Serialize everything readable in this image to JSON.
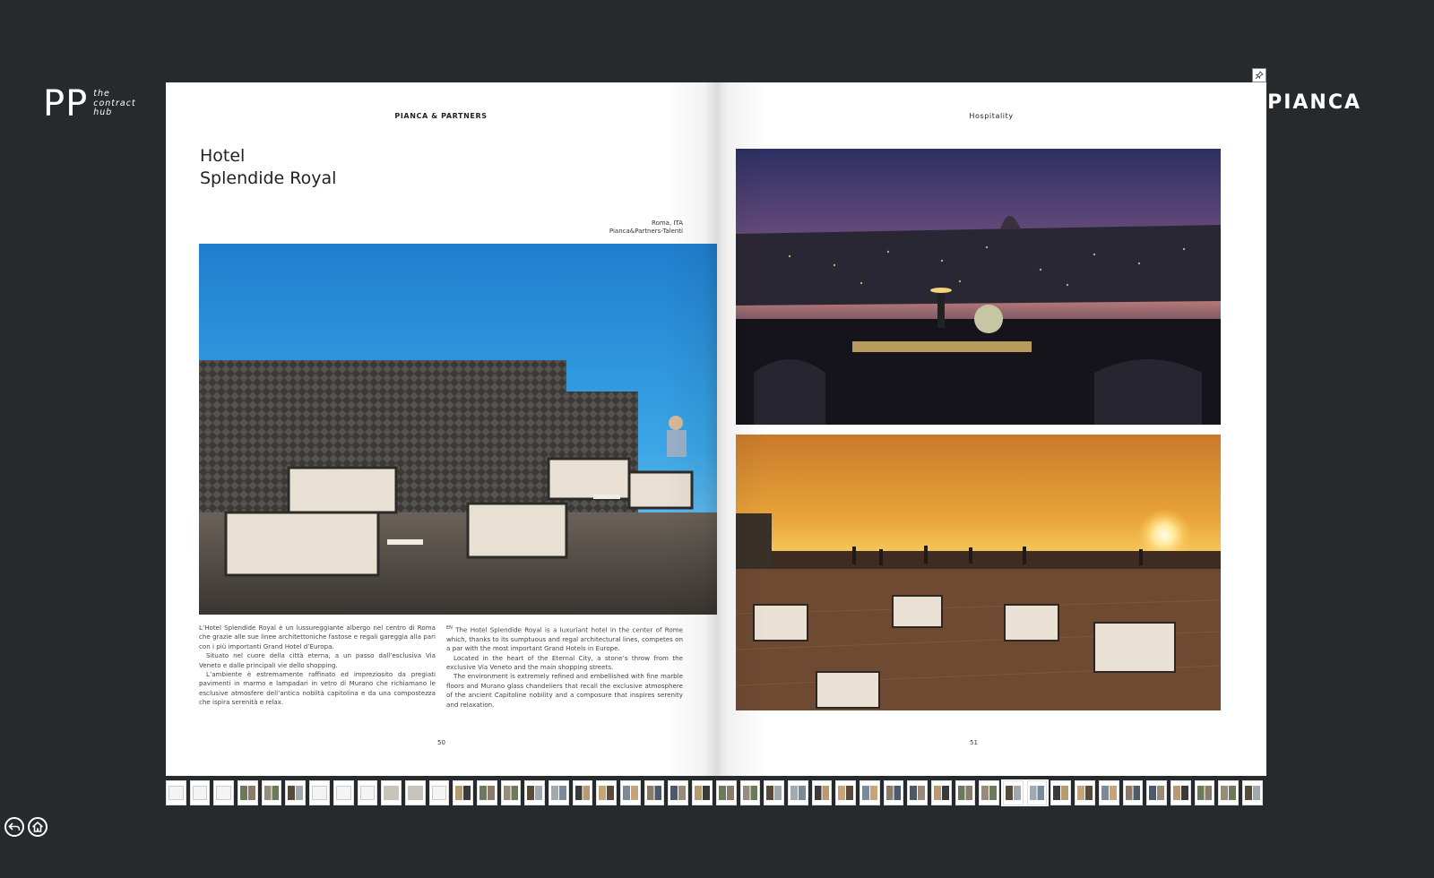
{
  "brand": {
    "pp_mark": "PP",
    "pp_tagline_1": "the",
    "pp_tagline_2": "contract",
    "pp_tagline_3": "hub",
    "pianca": "PIANCA"
  },
  "left_page": {
    "running_head": "PIANCA & PARTNERS",
    "title_line_1": "Hotel",
    "title_line_2": "Splendide Royal",
    "location_line_1": "Roma, ITA",
    "location_line_2": "Pianca&Partners-Talenti",
    "italian_paragraphs": [
      "L’Hotel Splendide Royal è un lussureggiante albergo nel centro di Roma che grazie alle sue linee architettoniche fastose e regali gareggia alla pari con i più importanti Grand Hotel d’Europa.",
      "Situato nel cuore della città eterna, a un passo dall’esclusiva Via Veneto e dalle principali vie dello shopping.",
      "L’ambiente è estremamente raffinato ed impreziosito da pregiati pavimenti in marmo e lampadari in vetro di Murano che richiamano le esclusive atmosfere dell’antica nobiltà capitolina e da una compostezza che ispira serenità e relax."
    ],
    "en_tag": "EN",
    "english_paragraphs": [
      "The Hotel Splendide Royal is a luxuriant hotel in the center of Rome which, thanks to its sumptuous and regal architectural lines, competes on a par with the most important Grand Hotels in Europe.",
      "Located in the heart of the Eternal City, a stone’s throw from the exclusive Via Veneto and the main shopping streets.",
      "The environment is extremely refined and embellished with fine marble floors and Murano glass chandeliers that recall the exclusive atmosphere of the ancient Capitoline nobility and a composure that inspires serenity and relaxation."
    ],
    "page_number": "50"
  },
  "right_page": {
    "running_head": "Hospitality",
    "page_number": "51"
  },
  "thumbnail_count": 46,
  "active_thumbnails": [
    35,
    36
  ]
}
